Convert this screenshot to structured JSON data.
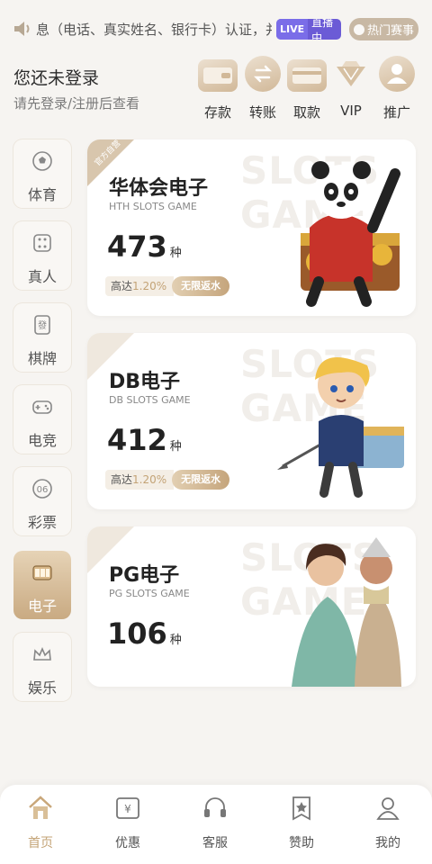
{
  "marquee": {
    "text": "息（电话、真实姓名、银行卡）认证，并"
  },
  "live": {
    "tag": "LIVE",
    "label": "直播中"
  },
  "hot": {
    "label": "热门赛事"
  },
  "login": {
    "title": "您还未登录",
    "subtitle": "请先登录/注册后查看"
  },
  "quick_actions": [
    {
      "label": "存款",
      "icon": "wallet-icon"
    },
    {
      "label": "转账",
      "icon": "transfer-icon"
    },
    {
      "label": "取款",
      "icon": "card-icon"
    },
    {
      "label": "VIP",
      "icon": "diamond-icon"
    },
    {
      "label": "推广",
      "icon": "person-icon"
    }
  ],
  "sidebar": [
    {
      "label": "体育",
      "icon": "soccer-ball-icon",
      "active": false
    },
    {
      "label": "真人",
      "icon": "dice-icon",
      "active": false
    },
    {
      "label": "棋牌",
      "icon": "mahjong-tile-icon",
      "active": false
    },
    {
      "label": "电竞",
      "icon": "gamepad-icon",
      "active": false
    },
    {
      "label": "彩票",
      "icon": "lottery-ball-icon",
      "active": false
    },
    {
      "label": "电子",
      "icon": "slot-machine-icon",
      "active": true
    },
    {
      "label": "娱乐",
      "icon": "crown-icon",
      "active": false
    }
  ],
  "games": [
    {
      "name": "华体会电子",
      "sub": "HTH SLOTS GAME",
      "count": "473",
      "unit": "种",
      "rebate_prefix": "高达",
      "rebate_pct": "1.20%",
      "rebate_tag": "无限返水",
      "corner": "官方自营",
      "watermark": "SLOTS GAME"
    },
    {
      "name": "DB电子",
      "sub": "DB SLOTS GAME",
      "count": "412",
      "unit": "种",
      "rebate_prefix": "高达",
      "rebate_pct": "1.20%",
      "rebate_tag": "无限返水",
      "corner": "",
      "watermark": "SLOTS GAME"
    },
    {
      "name": "PG电子",
      "sub": "PG SLOTS GAME",
      "count": "106",
      "unit": "种",
      "corner": "",
      "watermark": "SLOTS GAME"
    }
  ],
  "bottom_nav": [
    {
      "label": "首页",
      "icon": "home-icon",
      "active": true
    },
    {
      "label": "优惠",
      "icon": "voucher-icon",
      "active": false
    },
    {
      "label": "客服",
      "icon": "headset-icon",
      "active": false
    },
    {
      "label": "赞助",
      "icon": "sponsor-badge-icon",
      "active": false
    },
    {
      "label": "我的",
      "icon": "user-icon",
      "active": false
    }
  ],
  "colors": {
    "accent": "#c3a376",
    "background": "#f6f4f1",
    "live": "#6b5bd6"
  }
}
